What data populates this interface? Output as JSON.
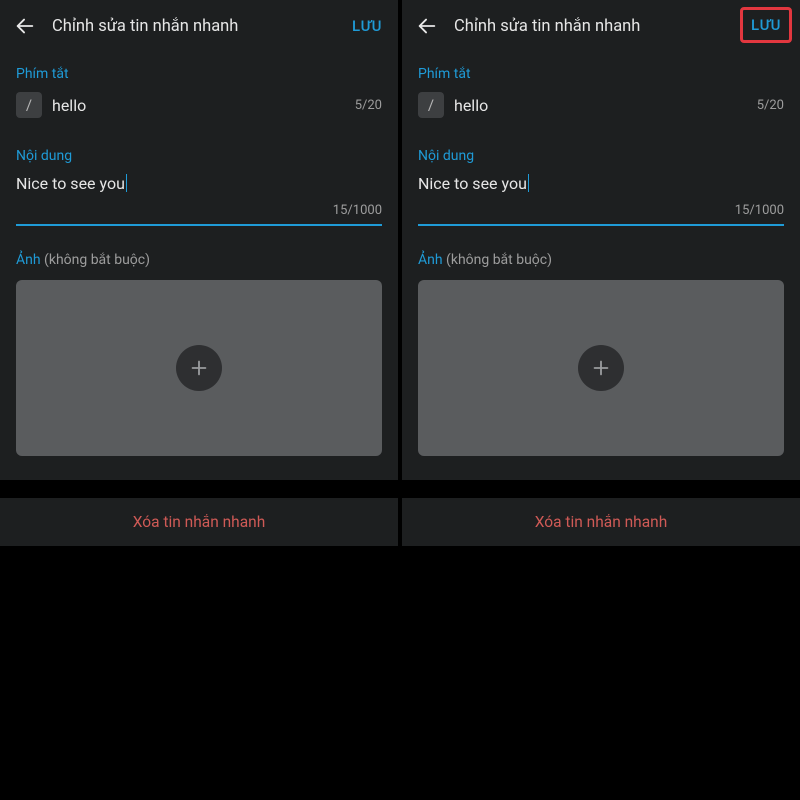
{
  "header": {
    "title": "Chỉnh sửa tin nhắn nhanh",
    "save_label": "LƯU"
  },
  "shortcut": {
    "label": "Phím tắt",
    "slash": "/",
    "value": "hello",
    "counter": "5/20"
  },
  "content": {
    "label": "Nội dung",
    "value": "Nice to see you",
    "counter": "15/1000"
  },
  "image": {
    "label_accent": "Ảnh",
    "label_muted": " (không bắt buộc)"
  },
  "delete_label": "Xóa tin nhắn nhanh"
}
